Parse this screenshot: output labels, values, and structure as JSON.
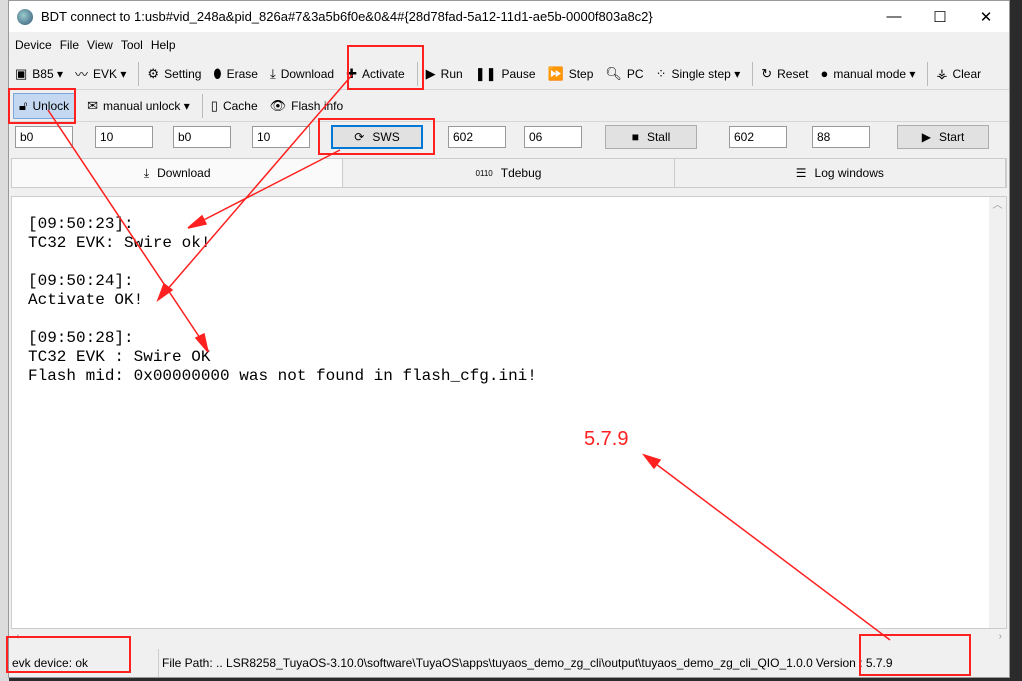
{
  "window": {
    "title": "BDT connect to 1:usb#vid_248a&pid_826a#7&3a5b6f0e&0&4#{28d78fad-5a12-11d1-ae5b-0000f803a8c2}",
    "minimize": "—",
    "maximize": "☐",
    "close": "✕"
  },
  "menu": [
    "Device",
    "File",
    "View",
    "Tool",
    "Help"
  ],
  "toolbar1": {
    "chip": "B85",
    "evk": "EVK",
    "setting": "Setting",
    "erase": "Erase",
    "download": "Download",
    "activate": "Activate",
    "run": "Run",
    "pause": "Pause",
    "step": "Step",
    "pc": "PC",
    "single_step": "Single step",
    "reset": "Reset",
    "manual_mode": "manual mode",
    "clear": "Clear"
  },
  "toolbar2": {
    "unlock": "Unlock",
    "manual_unlock": "manual unlock",
    "cache": "Cache",
    "flash_info": "Flash info"
  },
  "inputs": {
    "f1": "b0",
    "f2": "10",
    "f3": "b0",
    "f4": "10",
    "sws": "SWS",
    "f5": "602",
    "f6": "06",
    "stall": "Stall",
    "f7": "602",
    "f8": "88",
    "start": "Start"
  },
  "tabs": [
    {
      "label": "Download",
      "icon": "download-icon"
    },
    {
      "label": "Tdebug",
      "icon": "binary-icon"
    },
    {
      "label": "Log windows",
      "icon": "list-icon"
    }
  ],
  "log": [
    "[09:50:23]:",
    "TC32 EVK: Swire ok!",
    "",
    "[09:50:24]:",
    "Activate OK!",
    "",
    "[09:50:28]:",
    "TC32 EVK : Swire OK",
    "Flash mid: 0x00000000 was not found in flash_cfg.ini!"
  ],
  "status": {
    "device": "evk device: ok",
    "file_path": "File Path:   ..  LSR8258_TuyaOS-3.10.0\\software\\TuyaOS\\apps\\tuyaos_demo_zg_cli\\output\\tuyaos_demo_zg_cli_QIO_1.0.0",
    "version": "Version : 5.7.9"
  },
  "annotation": {
    "text": "5.7.9",
    "color": "#ff2020"
  }
}
